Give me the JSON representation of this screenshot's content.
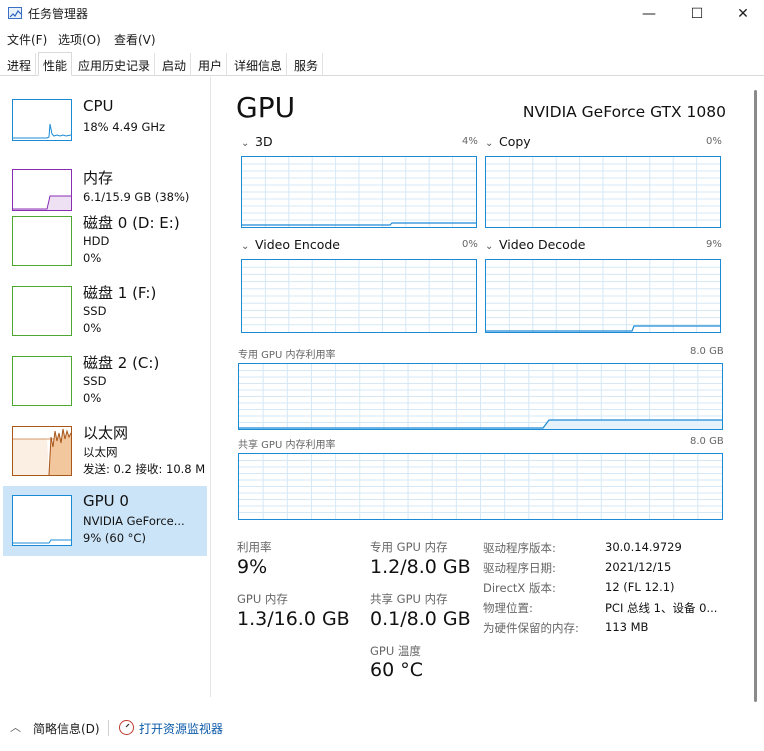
{
  "window": {
    "title": "任务管理器",
    "minimize": "—",
    "maximize": "☐",
    "close": "✕"
  },
  "menu": [
    "文件(F)",
    "选项(O)",
    "查看(V)"
  ],
  "tabs": [
    "进程",
    "性能",
    "应用历史记录",
    "启动",
    "用户",
    "详细信息",
    "服务"
  ],
  "active_tab": "性能",
  "sidebar": [
    {
      "name": "CPU",
      "lines": [
        "18% 4.49 GHz"
      ],
      "color": "#1c8bd6"
    },
    {
      "name": "内存",
      "lines": [
        "6.1/15.9 GB (38%)"
      ],
      "color": "#8b2db3"
    },
    {
      "name": "磁盘 0 (D: E:)",
      "lines": [
        "HDD",
        "0%"
      ],
      "color": "#4da832"
    },
    {
      "name": "磁盘 1 (F:)",
      "lines": [
        "SSD",
        "0%"
      ],
      "color": "#4da832"
    },
    {
      "name": "磁盘 2 (C:)",
      "lines": [
        "SSD",
        "0%"
      ],
      "color": "#4da832"
    },
    {
      "name": "以太网",
      "lines": [
        "以太网",
        "发送: 0.2  接收: 10.8 M"
      ],
      "color": "#a8561a"
    },
    {
      "name": "GPU 0",
      "lines": [
        "NVIDIA GeForce...",
        "9% (60 °C)"
      ],
      "color": "#1c8bd6",
      "selected": true
    }
  ],
  "main": {
    "title": "GPU",
    "model": "NVIDIA GeForce GTX 1080",
    "engines": [
      {
        "label": "3D",
        "percent": "4%"
      },
      {
        "label": "Copy",
        "percent": "0%"
      },
      {
        "label": "Video Encode",
        "percent": "0%"
      },
      {
        "label": "Video Decode",
        "percent": "9%"
      }
    ],
    "dedicated_label": "专用 GPU 内存利用率",
    "dedicated_max": "8.0 GB",
    "shared_label": "共享 GPU 内存利用率",
    "shared_max": "8.0 GB"
  },
  "stats": {
    "utilization_label": "利用率",
    "utilization": "9%",
    "dedicated_mem_label": "专用 GPU 内存",
    "dedicated_mem": "1.2/8.0 GB",
    "gpu_mem_label": "GPU 内存",
    "gpu_mem": "1.3/16.0 GB",
    "shared_mem_label": "共享 GPU 内存",
    "shared_mem": "0.1/8.0 GB",
    "temp_label": "GPU 温度",
    "temp": "60 °C"
  },
  "driver_info": [
    {
      "key": "驱动程序版本:",
      "value": "30.0.14.9729"
    },
    {
      "key": "驱动程序日期:",
      "value": "2021/12/15"
    },
    {
      "key": "DirectX 版本:",
      "value": "12 (FL 12.1)"
    },
    {
      "key": "物理位置:",
      "value": "PCI 总线 1、设备 0..."
    },
    {
      "key": "为硬件保留的内存:",
      "value": "113 MB"
    }
  ],
  "bottom": {
    "fewer_details": "简略信息(D)",
    "open_monitor": "打开资源监视器"
  },
  "colors": {
    "gpu_line": "#1c8bd6",
    "grid": "#d6e8f5",
    "selected_bg": "#cce4f7"
  }
}
